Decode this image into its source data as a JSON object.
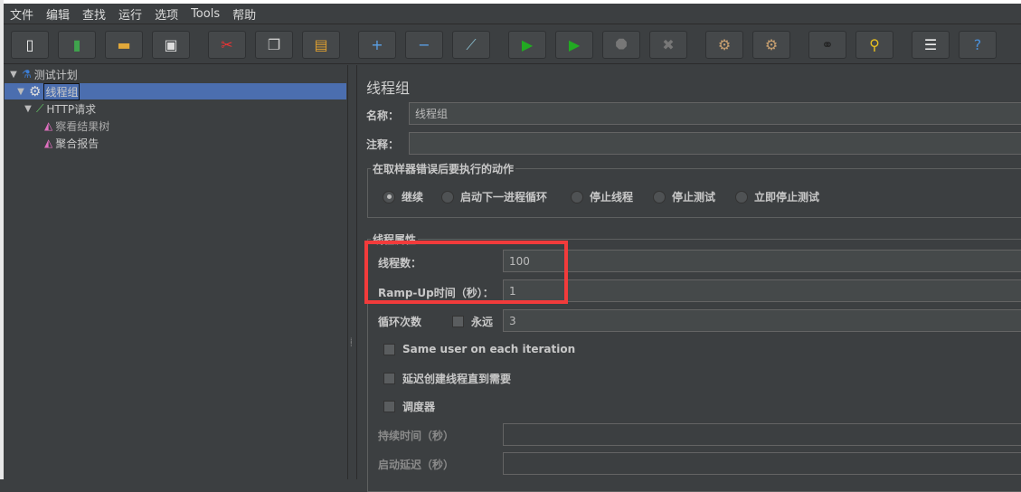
{
  "menu": [
    "文件",
    "编辑",
    "查找",
    "运行",
    "选项",
    "Tools",
    "帮助"
  ],
  "toolbar": [
    {
      "icon": "new-icon",
      "g": "▯",
      "c": "#f4f4f4"
    },
    {
      "icon": "templates-icon",
      "g": "▮",
      "c": "#3fa34d"
    },
    {
      "icon": "open-icon",
      "g": "▬",
      "c": "#e1a83a"
    },
    {
      "icon": "save-icon",
      "g": "▣",
      "c": "#dddddd"
    },
    {
      "icon": "cut-icon",
      "g": "✂",
      "c": "#e33"
    },
    {
      "icon": "copy-icon",
      "g": "❐",
      "c": "#ccc"
    },
    {
      "icon": "paste-icon",
      "g": "▤",
      "c": "#e0a030"
    },
    {
      "icon": "expand-icon",
      "g": "+",
      "c": "#5aa0e6"
    },
    {
      "icon": "collapse-icon",
      "g": "−",
      "c": "#5aa0e6"
    },
    {
      "icon": "toggle-icon",
      "g": "⟋",
      "c": "#8bc"
    },
    {
      "icon": "start-icon",
      "g": "▶",
      "c": "#22aa22"
    },
    {
      "icon": "start-no-pauses-icon",
      "g": "▶",
      "c": "#22aa22"
    },
    {
      "icon": "stop-icon",
      "g": "⯃",
      "c": "#777"
    },
    {
      "icon": "shutdown-icon",
      "g": "✖",
      "c": "#777"
    },
    {
      "icon": "clear-icon",
      "g": "⚙",
      "c": "#c8a070"
    },
    {
      "icon": "clear-all-icon",
      "g": "⚙",
      "c": "#c8a070"
    },
    {
      "icon": "search-icon",
      "g": "⚭",
      "c": "#222"
    },
    {
      "icon": "reset-search-icon",
      "g": "⚲",
      "c": "#e8c020"
    },
    {
      "icon": "function-helper-icon",
      "g": "☰",
      "c": "#eee"
    },
    {
      "icon": "help-icon",
      "g": "?",
      "c": "#4a8fd8"
    }
  ],
  "tree": {
    "plan": "测试计划",
    "thread_group": "线程组",
    "http": "HTTP请求",
    "view_results": "察看结果树",
    "aggregate": "聚合报告"
  },
  "panel": {
    "title": "线程组",
    "name_label": "名称：",
    "name_value": "线程组",
    "comment_label": "注释：",
    "comment_value": "",
    "error_group": "在取样器错误后要执行的动作",
    "error_options": [
      "继续",
      "启动下一进程循环",
      "停止线程",
      "停止测试",
      "立即停止测试"
    ],
    "error_selected": "继续",
    "props_group": "线程属性",
    "threads_label": "线程数：",
    "threads_value": "100",
    "rampup_label": "Ramp-Up时间（秒）：",
    "rampup_value": "1",
    "loop_label": "循环次数",
    "forever_label": "永远",
    "forever_checked": false,
    "loop_value": "3",
    "same_user_label": "Same user on each iteration",
    "same_user_checked": false,
    "delay_label": "延迟创建线程直到需要",
    "delay_checked": false,
    "scheduler_label": "调度器",
    "scheduler_checked": false,
    "duration_label": "持续时间（秒）",
    "duration_value": "",
    "startup_label": "启动延迟（秒）",
    "startup_value": ""
  },
  "colors": {
    "highlight": "#f23b3b",
    "selection": "#4b6eaf"
  }
}
